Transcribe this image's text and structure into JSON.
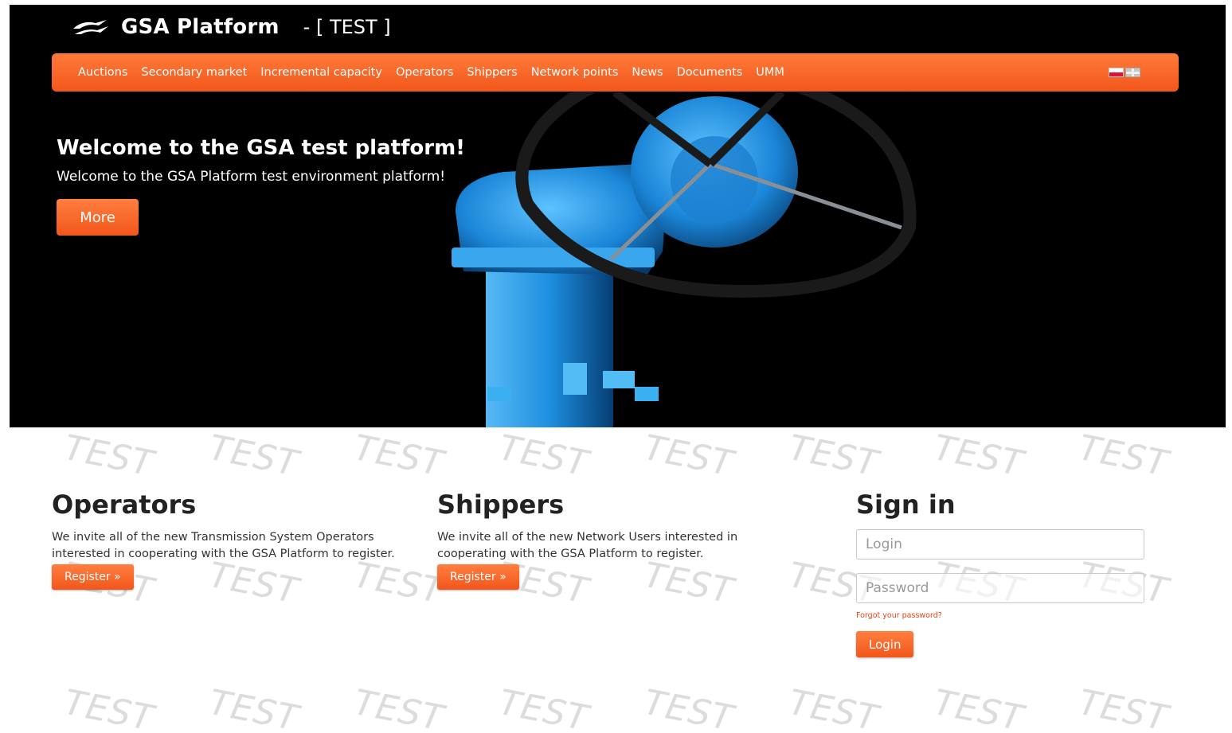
{
  "header": {
    "brand_name": "GSA Platform",
    "environment": "- [ TEST ]",
    "logo_icon": "gsa-arrows-logo"
  },
  "nav": {
    "items": [
      {
        "label": "Auctions"
      },
      {
        "label": "Secondary market"
      },
      {
        "label": "Incremental capacity"
      },
      {
        "label": "Operators"
      },
      {
        "label": "Shippers"
      },
      {
        "label": "Network points"
      },
      {
        "label": "News"
      },
      {
        "label": "Documents"
      },
      {
        "label": "UMM"
      }
    ],
    "languages": [
      "pl-flag-icon",
      "en-flag-icon"
    ]
  },
  "hero": {
    "title": "Welcome to the GSA test platform!",
    "subtitle": "Welcome to the GSA Platform test environment platform!",
    "button": "More"
  },
  "watermark": "TEST",
  "operators": {
    "title": "Operators",
    "text": "We invite all of the new Transmission System Operators interested in cooperating with the GSA Platform to register.",
    "button": "Register »"
  },
  "shippers": {
    "title": "Shippers",
    "text": "We invite all of the new Network Users interested in cooperating with the GSA Platform to register.",
    "button": "Register »"
  },
  "signin": {
    "title": "Sign in",
    "login_placeholder": "Login",
    "password_placeholder": "Password",
    "forgot": "Forgot your password?",
    "button": "Login"
  },
  "colors": {
    "accent": "#f2561b",
    "header_bg": "#000000"
  }
}
